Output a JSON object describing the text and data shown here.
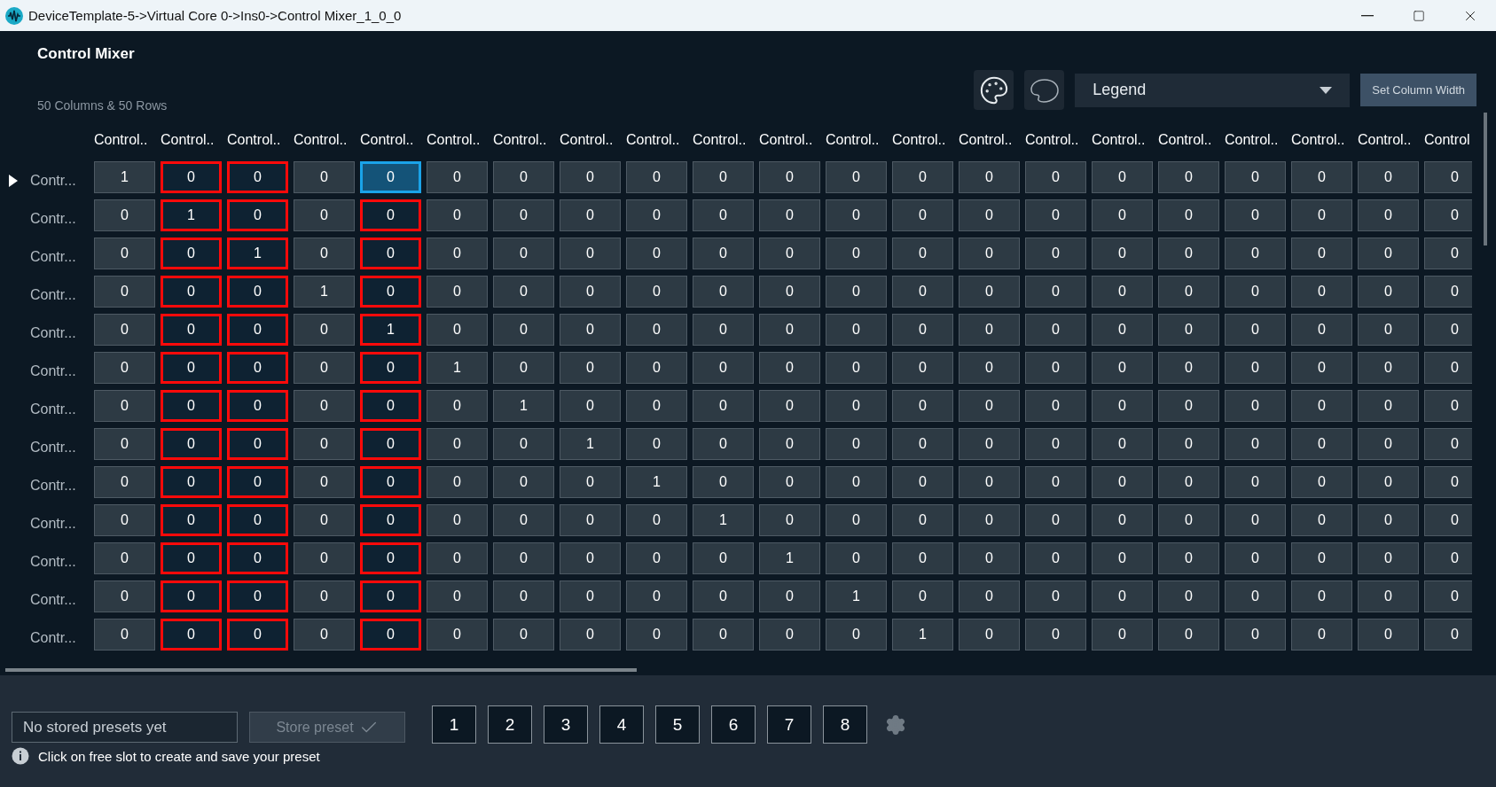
{
  "window": {
    "title": "DeviceTemplate-5->Virtual Core 0->Ins0->Control Mixer_1_0_0"
  },
  "header": {
    "title": "Control Mixer",
    "summary": "50 Columns & 50 Rows"
  },
  "toolbar": {
    "legend": {
      "value": "Legend"
    },
    "set_width_button": "Set Column Width"
  },
  "table": {
    "columns": [
      {
        "label": "Control..",
        "highlighted": false
      },
      {
        "label": "Control..",
        "highlighted": true
      },
      {
        "label": "Control..",
        "highlighted": true
      },
      {
        "label": "Control..",
        "highlighted": false
      },
      {
        "label": "Control..",
        "highlighted": true
      },
      {
        "label": "Control..",
        "highlighted": false
      },
      {
        "label": "Control..",
        "highlighted": false
      },
      {
        "label": "Control..",
        "highlighted": false
      },
      {
        "label": "Control..",
        "highlighted": false
      },
      {
        "label": "Control..",
        "highlighted": false
      },
      {
        "label": "Control..",
        "highlighted": false
      },
      {
        "label": "Control..",
        "highlighted": false
      },
      {
        "label": "Control..",
        "highlighted": false
      },
      {
        "label": "Control..",
        "highlighted": false
      },
      {
        "label": "Control..",
        "highlighted": false
      },
      {
        "label": "Control..",
        "highlighted": false
      },
      {
        "label": "Control..",
        "highlighted": false
      },
      {
        "label": "Control..",
        "highlighted": false
      },
      {
        "label": "Control..",
        "highlighted": false
      },
      {
        "label": "Control..",
        "highlighted": false
      },
      {
        "label": "Control",
        "highlighted": false
      }
    ],
    "rows": [
      {
        "label": "Contr...",
        "current": true,
        "cells": [
          {
            "value": "1",
            "selected": false
          },
          {
            "value": "0",
            "selected": false
          },
          {
            "value": "0",
            "selected": false
          },
          {
            "value": "0",
            "selected": false
          },
          {
            "value": "0",
            "selected": true
          },
          {
            "value": "0",
            "selected": false
          },
          {
            "value": "0",
            "selected": false
          },
          {
            "value": "0",
            "selected": false
          },
          {
            "value": "0",
            "selected": false
          },
          {
            "value": "0",
            "selected": false
          },
          {
            "value": "0",
            "selected": false
          },
          {
            "value": "0",
            "selected": false
          },
          {
            "value": "0",
            "selected": false
          },
          {
            "value": "0",
            "selected": false
          },
          {
            "value": "0",
            "selected": false
          },
          {
            "value": "0",
            "selected": false
          },
          {
            "value": "0",
            "selected": false
          },
          {
            "value": "0",
            "selected": false
          },
          {
            "value": "0",
            "selected": false
          },
          {
            "value": "0",
            "selected": false
          },
          {
            "value": "0",
            "selected": false
          }
        ]
      },
      {
        "label": "Contr...",
        "current": false,
        "cells": [
          {
            "value": "0",
            "selected": false
          },
          {
            "value": "1",
            "selected": false
          },
          {
            "value": "0",
            "selected": false
          },
          {
            "value": "0",
            "selected": false
          },
          {
            "value": "0",
            "selected": false
          },
          {
            "value": "0",
            "selected": false
          },
          {
            "value": "0",
            "selected": false
          },
          {
            "value": "0",
            "selected": false
          },
          {
            "value": "0",
            "selected": false
          },
          {
            "value": "0",
            "selected": false
          },
          {
            "value": "0",
            "selected": false
          },
          {
            "value": "0",
            "selected": false
          },
          {
            "value": "0",
            "selected": false
          },
          {
            "value": "0",
            "selected": false
          },
          {
            "value": "0",
            "selected": false
          },
          {
            "value": "0",
            "selected": false
          },
          {
            "value": "0",
            "selected": false
          },
          {
            "value": "0",
            "selected": false
          },
          {
            "value": "0",
            "selected": false
          },
          {
            "value": "0",
            "selected": false
          },
          {
            "value": "0",
            "selected": false
          }
        ]
      },
      {
        "label": "Contr...",
        "current": false,
        "cells": [
          {
            "value": "0",
            "selected": false
          },
          {
            "value": "0",
            "selected": false
          },
          {
            "value": "1",
            "selected": false
          },
          {
            "value": "0",
            "selected": false
          },
          {
            "value": "0",
            "selected": false
          },
          {
            "value": "0",
            "selected": false
          },
          {
            "value": "0",
            "selected": false
          },
          {
            "value": "0",
            "selected": false
          },
          {
            "value": "0",
            "selected": false
          },
          {
            "value": "0",
            "selected": false
          },
          {
            "value": "0",
            "selected": false
          },
          {
            "value": "0",
            "selected": false
          },
          {
            "value": "0",
            "selected": false
          },
          {
            "value": "0",
            "selected": false
          },
          {
            "value": "0",
            "selected": false
          },
          {
            "value": "0",
            "selected": false
          },
          {
            "value": "0",
            "selected": false
          },
          {
            "value": "0",
            "selected": false
          },
          {
            "value": "0",
            "selected": false
          },
          {
            "value": "0",
            "selected": false
          },
          {
            "value": "0",
            "selected": false
          }
        ]
      },
      {
        "label": "Contr...",
        "current": false,
        "cells": [
          {
            "value": "0",
            "selected": false
          },
          {
            "value": "0",
            "selected": false
          },
          {
            "value": "0",
            "selected": false
          },
          {
            "value": "1",
            "selected": false
          },
          {
            "value": "0",
            "selected": false
          },
          {
            "value": "0",
            "selected": false
          },
          {
            "value": "0",
            "selected": false
          },
          {
            "value": "0",
            "selected": false
          },
          {
            "value": "0",
            "selected": false
          },
          {
            "value": "0",
            "selected": false
          },
          {
            "value": "0",
            "selected": false
          },
          {
            "value": "0",
            "selected": false
          },
          {
            "value": "0",
            "selected": false
          },
          {
            "value": "0",
            "selected": false
          },
          {
            "value": "0",
            "selected": false
          },
          {
            "value": "0",
            "selected": false
          },
          {
            "value": "0",
            "selected": false
          },
          {
            "value": "0",
            "selected": false
          },
          {
            "value": "0",
            "selected": false
          },
          {
            "value": "0",
            "selected": false
          },
          {
            "value": "0",
            "selected": false
          }
        ]
      },
      {
        "label": "Contr...",
        "current": false,
        "cells": [
          {
            "value": "0",
            "selected": false
          },
          {
            "value": "0",
            "selected": false
          },
          {
            "value": "0",
            "selected": false
          },
          {
            "value": "0",
            "selected": false
          },
          {
            "value": "1",
            "selected": false
          },
          {
            "value": "0",
            "selected": false
          },
          {
            "value": "0",
            "selected": false
          },
          {
            "value": "0",
            "selected": false
          },
          {
            "value": "0",
            "selected": false
          },
          {
            "value": "0",
            "selected": false
          },
          {
            "value": "0",
            "selected": false
          },
          {
            "value": "0",
            "selected": false
          },
          {
            "value": "0",
            "selected": false
          },
          {
            "value": "0",
            "selected": false
          },
          {
            "value": "0",
            "selected": false
          },
          {
            "value": "0",
            "selected": false
          },
          {
            "value": "0",
            "selected": false
          },
          {
            "value": "0",
            "selected": false
          },
          {
            "value": "0",
            "selected": false
          },
          {
            "value": "0",
            "selected": false
          },
          {
            "value": "0",
            "selected": false
          }
        ]
      },
      {
        "label": "Contr...",
        "current": false,
        "cells": [
          {
            "value": "0",
            "selected": false
          },
          {
            "value": "0",
            "selected": false
          },
          {
            "value": "0",
            "selected": false
          },
          {
            "value": "0",
            "selected": false
          },
          {
            "value": "0",
            "selected": false
          },
          {
            "value": "1",
            "selected": false
          },
          {
            "value": "0",
            "selected": false
          },
          {
            "value": "0",
            "selected": false
          },
          {
            "value": "0",
            "selected": false
          },
          {
            "value": "0",
            "selected": false
          },
          {
            "value": "0",
            "selected": false
          },
          {
            "value": "0",
            "selected": false
          },
          {
            "value": "0",
            "selected": false
          },
          {
            "value": "0",
            "selected": false
          },
          {
            "value": "0",
            "selected": false
          },
          {
            "value": "0",
            "selected": false
          },
          {
            "value": "0",
            "selected": false
          },
          {
            "value": "0",
            "selected": false
          },
          {
            "value": "0",
            "selected": false
          },
          {
            "value": "0",
            "selected": false
          },
          {
            "value": "0",
            "selected": false
          }
        ]
      },
      {
        "label": "Contr...",
        "current": false,
        "cells": [
          {
            "value": "0",
            "selected": false
          },
          {
            "value": "0",
            "selected": false
          },
          {
            "value": "0",
            "selected": false
          },
          {
            "value": "0",
            "selected": false
          },
          {
            "value": "0",
            "selected": false
          },
          {
            "value": "0",
            "selected": false
          },
          {
            "value": "1",
            "selected": false
          },
          {
            "value": "0",
            "selected": false
          },
          {
            "value": "0",
            "selected": false
          },
          {
            "value": "0",
            "selected": false
          },
          {
            "value": "0",
            "selected": false
          },
          {
            "value": "0",
            "selected": false
          },
          {
            "value": "0",
            "selected": false
          },
          {
            "value": "0",
            "selected": false
          },
          {
            "value": "0",
            "selected": false
          },
          {
            "value": "0",
            "selected": false
          },
          {
            "value": "0",
            "selected": false
          },
          {
            "value": "0",
            "selected": false
          },
          {
            "value": "0",
            "selected": false
          },
          {
            "value": "0",
            "selected": false
          },
          {
            "value": "0",
            "selected": false
          }
        ]
      },
      {
        "label": "Contr...",
        "current": false,
        "cells": [
          {
            "value": "0",
            "selected": false
          },
          {
            "value": "0",
            "selected": false
          },
          {
            "value": "0",
            "selected": false
          },
          {
            "value": "0",
            "selected": false
          },
          {
            "value": "0",
            "selected": false
          },
          {
            "value": "0",
            "selected": false
          },
          {
            "value": "0",
            "selected": false
          },
          {
            "value": "1",
            "selected": false
          },
          {
            "value": "0",
            "selected": false
          },
          {
            "value": "0",
            "selected": false
          },
          {
            "value": "0",
            "selected": false
          },
          {
            "value": "0",
            "selected": false
          },
          {
            "value": "0",
            "selected": false
          },
          {
            "value": "0",
            "selected": false
          },
          {
            "value": "0",
            "selected": false
          },
          {
            "value": "0",
            "selected": false
          },
          {
            "value": "0",
            "selected": false
          },
          {
            "value": "0",
            "selected": false
          },
          {
            "value": "0",
            "selected": false
          },
          {
            "value": "0",
            "selected": false
          },
          {
            "value": "0",
            "selected": false
          }
        ]
      },
      {
        "label": "Contr...",
        "current": false,
        "cells": [
          {
            "value": "0",
            "selected": false
          },
          {
            "value": "0",
            "selected": false
          },
          {
            "value": "0",
            "selected": false
          },
          {
            "value": "0",
            "selected": false
          },
          {
            "value": "0",
            "selected": false
          },
          {
            "value": "0",
            "selected": false
          },
          {
            "value": "0",
            "selected": false
          },
          {
            "value": "0",
            "selected": false
          },
          {
            "value": "1",
            "selected": false
          },
          {
            "value": "0",
            "selected": false
          },
          {
            "value": "0",
            "selected": false
          },
          {
            "value": "0",
            "selected": false
          },
          {
            "value": "0",
            "selected": false
          },
          {
            "value": "0",
            "selected": false
          },
          {
            "value": "0",
            "selected": false
          },
          {
            "value": "0",
            "selected": false
          },
          {
            "value": "0",
            "selected": false
          },
          {
            "value": "0",
            "selected": false
          },
          {
            "value": "0",
            "selected": false
          },
          {
            "value": "0",
            "selected": false
          },
          {
            "value": "0",
            "selected": false
          }
        ]
      },
      {
        "label": "Contr...",
        "current": false,
        "cells": [
          {
            "value": "0",
            "selected": false
          },
          {
            "value": "0",
            "selected": false
          },
          {
            "value": "0",
            "selected": false
          },
          {
            "value": "0",
            "selected": false
          },
          {
            "value": "0",
            "selected": false
          },
          {
            "value": "0",
            "selected": false
          },
          {
            "value": "0",
            "selected": false
          },
          {
            "value": "0",
            "selected": false
          },
          {
            "value": "0",
            "selected": false
          },
          {
            "value": "1",
            "selected": false
          },
          {
            "value": "0",
            "selected": false
          },
          {
            "value": "0",
            "selected": false
          },
          {
            "value": "0",
            "selected": false
          },
          {
            "value": "0",
            "selected": false
          },
          {
            "value": "0",
            "selected": false
          },
          {
            "value": "0",
            "selected": false
          },
          {
            "value": "0",
            "selected": false
          },
          {
            "value": "0",
            "selected": false
          },
          {
            "value": "0",
            "selected": false
          },
          {
            "value": "0",
            "selected": false
          },
          {
            "value": "0",
            "selected": false
          }
        ]
      },
      {
        "label": "Contr...",
        "current": false,
        "cells": [
          {
            "value": "0",
            "selected": false
          },
          {
            "value": "0",
            "selected": false
          },
          {
            "value": "0",
            "selected": false
          },
          {
            "value": "0",
            "selected": false
          },
          {
            "value": "0",
            "selected": false
          },
          {
            "value": "0",
            "selected": false
          },
          {
            "value": "0",
            "selected": false
          },
          {
            "value": "0",
            "selected": false
          },
          {
            "value": "0",
            "selected": false
          },
          {
            "value": "0",
            "selected": false
          },
          {
            "value": "1",
            "selected": false
          },
          {
            "value": "0",
            "selected": false
          },
          {
            "value": "0",
            "selected": false
          },
          {
            "value": "0",
            "selected": false
          },
          {
            "value": "0",
            "selected": false
          },
          {
            "value": "0",
            "selected": false
          },
          {
            "value": "0",
            "selected": false
          },
          {
            "value": "0",
            "selected": false
          },
          {
            "value": "0",
            "selected": false
          },
          {
            "value": "0",
            "selected": false
          },
          {
            "value": "0",
            "selected": false
          }
        ]
      },
      {
        "label": "Contr...",
        "current": false,
        "cells": [
          {
            "value": "0",
            "selected": false
          },
          {
            "value": "0",
            "selected": false
          },
          {
            "value": "0",
            "selected": false
          },
          {
            "value": "0",
            "selected": false
          },
          {
            "value": "0",
            "selected": false
          },
          {
            "value": "0",
            "selected": false
          },
          {
            "value": "0",
            "selected": false
          },
          {
            "value": "0",
            "selected": false
          },
          {
            "value": "0",
            "selected": false
          },
          {
            "value": "0",
            "selected": false
          },
          {
            "value": "0",
            "selected": false
          },
          {
            "value": "1",
            "selected": false
          },
          {
            "value": "0",
            "selected": false
          },
          {
            "value": "0",
            "selected": false
          },
          {
            "value": "0",
            "selected": false
          },
          {
            "value": "0",
            "selected": false
          },
          {
            "value": "0",
            "selected": false
          },
          {
            "value": "0",
            "selected": false
          },
          {
            "value": "0",
            "selected": false
          },
          {
            "value": "0",
            "selected": false
          },
          {
            "value": "0",
            "selected": false
          }
        ]
      },
      {
        "label": "Contr...",
        "current": false,
        "cells": [
          {
            "value": "0",
            "selected": false
          },
          {
            "value": "0",
            "selected": false
          },
          {
            "value": "0",
            "selected": false
          },
          {
            "value": "0",
            "selected": false
          },
          {
            "value": "0",
            "selected": false
          },
          {
            "value": "0",
            "selected": false
          },
          {
            "value": "0",
            "selected": false
          },
          {
            "value": "0",
            "selected": false
          },
          {
            "value": "0",
            "selected": false
          },
          {
            "value": "0",
            "selected": false
          },
          {
            "value": "0",
            "selected": false
          },
          {
            "value": "0",
            "selected": false
          },
          {
            "value": "1",
            "selected": false
          },
          {
            "value": "0",
            "selected": false
          },
          {
            "value": "0",
            "selected": false
          },
          {
            "value": "0",
            "selected": false
          },
          {
            "value": "0",
            "selected": false
          },
          {
            "value": "0",
            "selected": false
          },
          {
            "value": "0",
            "selected": false
          },
          {
            "value": "0",
            "selected": false
          },
          {
            "value": "0",
            "selected": false
          }
        ]
      }
    ]
  },
  "presets": {
    "field": {
      "placeholder": "No stored presets yet"
    },
    "store_button": {
      "label": "Store preset",
      "disabled": true
    },
    "slots": [
      "1",
      "2",
      "3",
      "4",
      "5",
      "6",
      "7",
      "8"
    ],
    "hint": "Click on free slot to create and save your preset"
  }
}
